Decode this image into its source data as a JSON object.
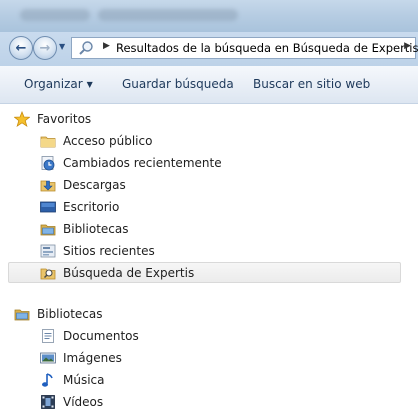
{
  "address": {
    "path_text": "Resultados de la búsqueda en Búsqueda de Expertis"
  },
  "toolbar": {
    "organize_label": "Organizar",
    "save_search_label": "Guardar búsqueda",
    "web_search_label": "Buscar en sitio web"
  },
  "favorites": {
    "label": "Favoritos",
    "icon": "star-icon",
    "items": [
      {
        "label": "Acceso público",
        "icon": "folder-icon"
      },
      {
        "label": "Cambiados recientemente",
        "icon": "recent-changes-icon"
      },
      {
        "label": "Descargas",
        "icon": "downloads-icon"
      },
      {
        "label": "Escritorio",
        "icon": "desktop-icon"
      },
      {
        "label": "Bibliotecas",
        "icon": "libraries-icon"
      },
      {
        "label": "Sitios recientes",
        "icon": "recent-places-icon"
      },
      {
        "label": "Búsqueda de Expertis",
        "icon": "saved-search-icon"
      }
    ]
  },
  "libraries": {
    "label": "Bibliotecas",
    "icon": "libraries-icon",
    "items": [
      {
        "label": "Documentos",
        "icon": "documents-icon"
      },
      {
        "label": "Imágenes",
        "icon": "pictures-icon"
      },
      {
        "label": "Música",
        "icon": "music-icon"
      },
      {
        "label": "Vídeos",
        "icon": "videos-icon"
      }
    ]
  },
  "colors": {
    "toolbar_text": "#1e395b",
    "selected_bg": "#ececec",
    "chrome_blue": "#bdd2e8"
  }
}
